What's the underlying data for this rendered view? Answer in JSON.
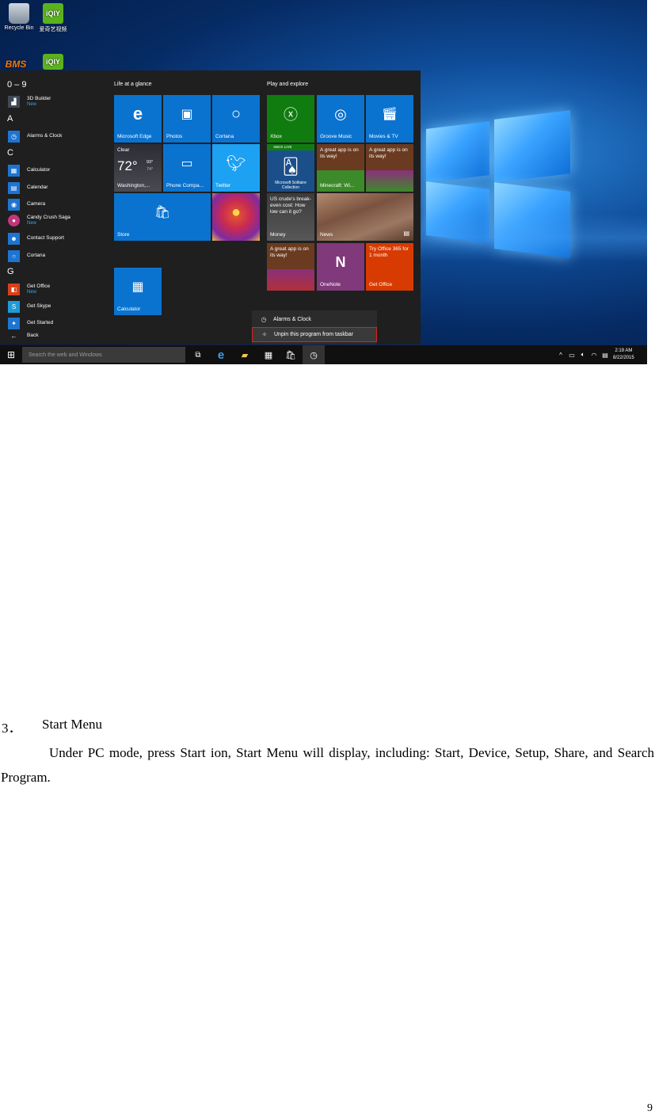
{
  "desktop": {
    "icons": [
      {
        "label": "Recycle Bin",
        "icon": "recycle-bin-icon"
      },
      {
        "label": "爱奇艺视频",
        "icon": "iqiyi-icon"
      },
      {
        "label": "",
        "icon": "bms-icon"
      },
      {
        "label": "",
        "icon": "iqiyi-icon"
      }
    ],
    "bms_logo_text": "BMS",
    "iqiyi_logo_text": "iQIY"
  },
  "start_menu": {
    "app_list": {
      "sections": [
        {
          "letter": "0 – 9",
          "apps": [
            {
              "name": "3D Builder",
              "badge": "New",
              "icon": "3d-builder-icon",
              "color": "#404a57"
            }
          ]
        },
        {
          "letter": "A",
          "apps": [
            {
              "name": "Alarms & Clock",
              "badge": "",
              "icon": "alarm-clock-icon",
              "color": "#1e74d1"
            }
          ]
        },
        {
          "letter": "C",
          "apps": [
            {
              "name": "Calculator",
              "badge": "",
              "icon": "calculator-icon",
              "color": "#1e74d1"
            },
            {
              "name": "Calendar",
              "badge": "",
              "icon": "calendar-icon",
              "color": "#1e74d1"
            },
            {
              "name": "Camera",
              "badge": "",
              "icon": "camera-icon",
              "color": "#1e74d1"
            },
            {
              "name": "Candy Crush Saga",
              "badge": "New",
              "icon": "candy-crush-icon",
              "color": "#c2357c"
            },
            {
              "name": "Contact Support",
              "badge": "",
              "icon": "contact-support-icon",
              "color": "#1e74d1"
            },
            {
              "name": "Cortana",
              "badge": "",
              "icon": "cortana-icon",
              "color": "#1e74d1"
            }
          ]
        },
        {
          "letter": "G",
          "apps": [
            {
              "name": "Get Office",
              "badge": "New",
              "icon": "office-icon",
              "color": "#d6401a"
            },
            {
              "name": "Get Skype",
              "badge": "",
              "icon": "skype-icon",
              "color": "#1e9bd9"
            },
            {
              "name": "Get Started",
              "badge": "",
              "icon": "get-started-icon",
              "color": "#1e74d1"
            }
          ]
        }
      ],
      "back_label": "Back"
    },
    "groups": [
      {
        "title": "Life at a glance"
      },
      {
        "title": "Play and explore"
      }
    ],
    "tiles": {
      "edge": "Microsoft Edge",
      "photos": "Photos",
      "cortana": "Cortana",
      "weather_condition": "Clear",
      "weather_temp": "72°",
      "weather_high": "93°",
      "weather_low": "74°",
      "weather_city": "Washington,...",
      "phone": "Phone Compa...",
      "twitter": "Twitter",
      "store": "Store",
      "calculator": "Calculator",
      "xbox": "Xbox",
      "groove": "Groove Music",
      "movies": "Movies & TV",
      "solitaire_badge": "XBOX LIVE",
      "solitaire": "Microsoft Solitaire Collection",
      "minecraft_msg": "A great app is on its way!",
      "minecraft": "Minecraft: Wi...",
      "app1_msg": "A great app is on its way!",
      "money_msg": "US crude's break-even cost: How low can it go?",
      "money": "Money",
      "news": "News",
      "app2_msg": "A great app is on its way!",
      "onenote": "OneNote",
      "office_msg": "Try Office 365 for 1 month",
      "office": "Get Office"
    }
  },
  "context_menu": {
    "items": [
      {
        "label": "Alarms & Clock",
        "icon": "alarm-clock-icon",
        "highlighted": false
      },
      {
        "label": "Unpin this program from taskbar",
        "icon": "unpin-icon",
        "highlighted": true
      }
    ],
    "highlight_color": "#e0201b"
  },
  "taskbar": {
    "search_placeholder": "Search the web and Windows",
    "time": "2:19 AM",
    "date": "8/22/2015"
  },
  "document": {
    "heading_number": "3．",
    "heading_text": "Start Menu",
    "body": "Under PC mode, press Start ion, Start Menu will display, including: Start, Device, Setup, Share, and Search Program.",
    "page_number": "9"
  }
}
